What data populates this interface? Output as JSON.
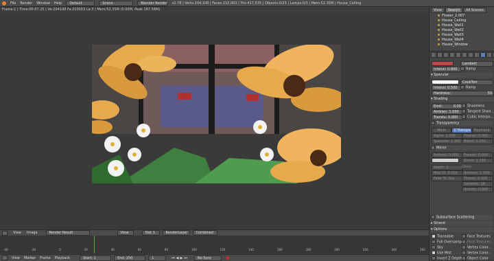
{
  "top_menu": {
    "items": [
      "File",
      "Render",
      "Window",
      "Help"
    ],
    "layout": "Default",
    "scene": "Scene",
    "engine": "Blender Render",
    "stats": "v2.78 | Verts:204,108 | Faces:210,003 | Tris:417,535 | Objects:0/25 | Lamps:0/3 | Mem:52.35M | House_Ceiling"
  },
  "viewport_info": "Frame:1 | Time:00:07.25 | Ve:204108 Fa:210003 La:3 | Mem:52.35M (0.00M, Peak 167.56M)",
  "outliner": {
    "tabs": [
      "View",
      "Search",
      "All Scenes"
    ],
    "items": [
      "Flower_2.007",
      "House_Ceiling",
      "House_Wall1",
      "House_Wall2",
      "House_Wall3",
      "House_Wall4",
      "House_Window"
    ]
  },
  "properties": {
    "diffuse": {
      "shader": "Lambert",
      "intensity": "Intensi: 0.800",
      "ramp": "Ramp"
    },
    "specular": {
      "title": "Specular",
      "shader": "CookTorr",
      "intensity": "Intensi: 0.500",
      "ramp": "Ramp",
      "hardness": "Hardness:",
      "hardness_value": "50"
    },
    "shading": {
      "title": "Shading",
      "emit": "Emit:",
      "emit_value": "0.00",
      "ambient": "Ambien: 1.000",
      "translucency": "Translu: 0.000",
      "shadeless": "Shadeless",
      "tangent": "Tangent Shad...",
      "cubic": "Cubic Interpo..."
    },
    "transparency": {
      "title": "Transparency",
      "modes": [
        "Mask",
        "Z Transpa",
        "Raytrace"
      ],
      "alpha": "Alpha: 1.000",
      "fresnel": "Fresnel: 0.000",
      "specular": "Specular: 1.000",
      "blend": "Blend: 1.250"
    },
    "mirror": {
      "title": "Mirror",
      "reflect": "Reflecti: 0.000",
      "fresnel": "Fresnel: 0.000",
      "blend": "Blend: 1.250",
      "depth": "Depth: 2",
      "max_dist": "Max Di: 0.000",
      "fade": "Fade To: Sky",
      "gloss": "Gloss:",
      "amount": "Amount: 1.000",
      "thresh": "Thresh: 0.005",
      "samples": "Samples: 18",
      "anisotropic": "Anisotr: 0.000"
    },
    "sss": "Subsurface Scattering",
    "strand": "Strand",
    "options": {
      "title": "Options",
      "traceable": "Traceable",
      "full_oversampling": "Full Oversampli...",
      "sky": "Sky",
      "use_mist": "Use Mist",
      "invert_z": "Invert Z Depth",
      "face_textures": "Face Textures",
      "face_textures_alpha": "Face Textures...",
      "vertex_color_paint": "Vertex Color...",
      "vertex_color_light": "Vertex Color...",
      "object_color": "Object Color"
    }
  },
  "image_header": {
    "items": [
      "View",
      "Image"
    ],
    "image": "Render Result",
    "view": "View",
    "slot": "Slot 1",
    "layer": "RenderLayer",
    "pass": "Combined"
  },
  "timeline": {
    "ticks": [
      "-40",
      "-20",
      "0",
      "20",
      "40",
      "60",
      "80",
      "100",
      "120",
      "140",
      "160",
      "180",
      "200",
      "220",
      "240",
      "260"
    ],
    "menu": [
      "View",
      "Marker",
      "Frame",
      "Playback"
    ],
    "start": "Start: 1",
    "end": "End: 250",
    "current": "1",
    "sync": "No Sync"
  },
  "colors": {
    "accent": "#5680c2",
    "flower_petal": "#e6aa4c",
    "flower_center": "#4a2a14",
    "daisy": "#f2f2f2",
    "grass": "#3f7f3f"
  }
}
